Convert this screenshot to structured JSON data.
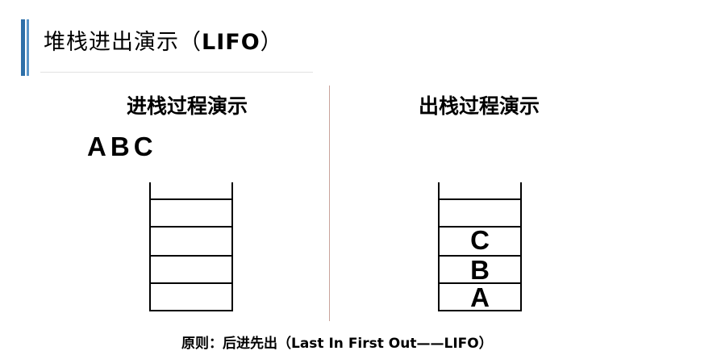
{
  "header": {
    "title_prefix": "堆栈进出演示（",
    "title_lifo": "LIFO",
    "title_suffix": "）"
  },
  "push_section": {
    "title": "进栈过程演示",
    "waiting_items": [
      "A",
      "B",
      "C"
    ]
  },
  "pop_section": {
    "title": "出栈过程演示",
    "stack_items_top_to_bottom": [
      "C",
      "B",
      "A"
    ]
  },
  "footer": {
    "principle": "原则：后进先出（Last In First Out——LIFO）"
  },
  "colors": {
    "accent": "#2e6fa8",
    "accent_light": "#5a95c8",
    "divider": "#c9a39b"
  }
}
